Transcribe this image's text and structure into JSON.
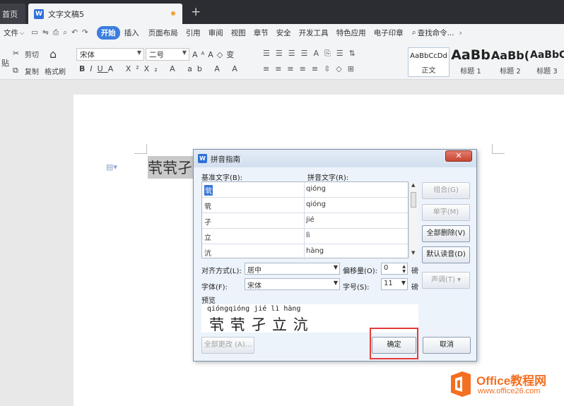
{
  "tabs": {
    "home": "首页",
    "document": "文字文稿5",
    "new_tab": "+"
  },
  "menubar": {
    "file": "文件",
    "items": [
      "开始",
      "插入",
      "页面布局",
      "引用",
      "审阅",
      "视图",
      "章节",
      "安全",
      "开发工具",
      "特色应用",
      "电子印章"
    ],
    "search": "查找命令..."
  },
  "ribbon": {
    "cut": "剪切",
    "copy": "复制",
    "format_painter": "格式刷",
    "paste": "贴",
    "font_name": "宋体",
    "font_size": "二号",
    "styles": [
      {
        "preview": "AaBbCcDd",
        "label": "正文"
      },
      {
        "preview": "AaBb",
        "label": "标题 1"
      },
      {
        "preview": "AaBb(",
        "label": "标题 2"
      },
      {
        "preview": "AaBbC",
        "label": "标题 3"
      }
    ]
  },
  "document": {
    "selected_text": "茕茕孑立沆"
  },
  "dialog": {
    "title": "拼音指南",
    "close": "✕",
    "col_base": "基准文字(B):",
    "col_pinyin": "拼音文字(R):",
    "rows": [
      {
        "base": "茕",
        "pinyin": "qióng"
      },
      {
        "base": "茕",
        "pinyin": "qióng"
      },
      {
        "base": "孑",
        "pinyin": "jié"
      },
      {
        "base": "立",
        "pinyin": "lì"
      },
      {
        "base": "沆",
        "pinyin": "hàng"
      }
    ],
    "buttons": {
      "group": "组合(G)",
      "single": "单字(M)",
      "clear_all": "全部删除(V)",
      "default_reading": "默认读音(D)",
      "tone": "声调(T)",
      "change_all": "全部更改 (A)...",
      "ok": "确定",
      "cancel": "取消"
    },
    "alignment_label": "对齐方式(L):",
    "alignment_value": "居中",
    "offset_label": "偏移量(O):",
    "offset_value": "0",
    "offset_unit": "磅",
    "font_label": "字体(F):",
    "font_value": "宋体",
    "size_label": "字号(S):",
    "size_value": "11",
    "size_unit": "磅",
    "preview_label": "预览",
    "preview_pinyin": "qióngqióng jié  lì hàng",
    "preview_base": "茕 茕 孑 立 沆"
  },
  "watermark": {
    "name": "Office教程网",
    "url": "www.office26.com"
  },
  "colors": {
    "accent": "#3b7de0",
    "highlight_box": "#e33a3a",
    "logo_orange": "#f36f21"
  }
}
